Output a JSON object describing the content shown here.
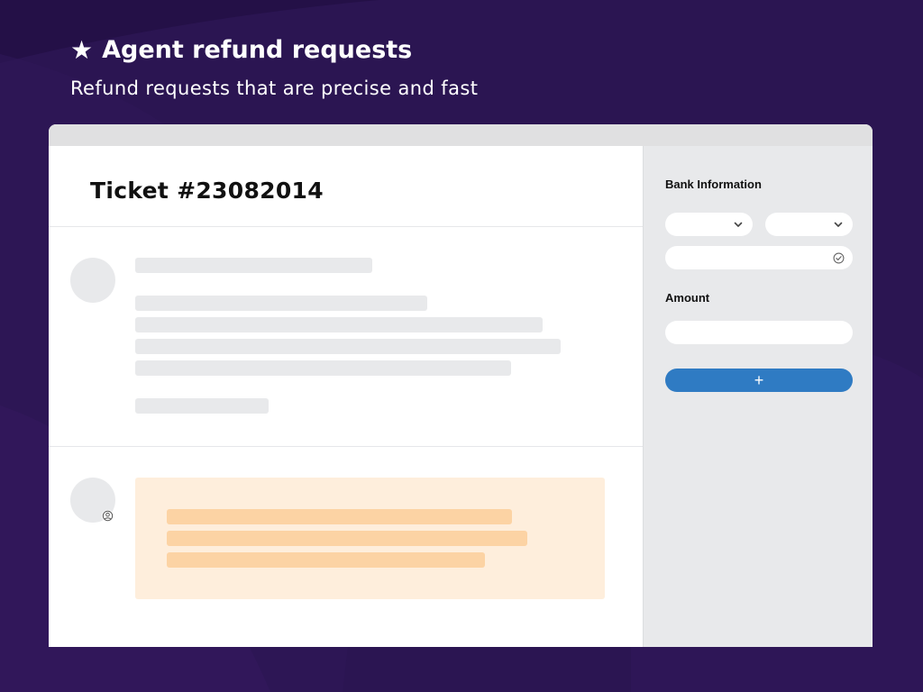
{
  "hero": {
    "star_icon": "star-icon",
    "title": "Agent refund requests",
    "subtitle": "Refund requests that are precise and fast"
  },
  "ticket": {
    "title": "Ticket #23082014"
  },
  "sidebar": {
    "bank_label": "Bank Information",
    "amount_label": "Amount",
    "add_icon": "+",
    "check_icon": "check-circle-icon",
    "chevron_icon": "chevron-down-icon"
  },
  "colors": {
    "background": "#2b1552",
    "accent_button": "#2f7bc3",
    "note_background": "#feeedc",
    "note_lines": "#fcd3a4",
    "skeleton": "#e8e9eb"
  }
}
